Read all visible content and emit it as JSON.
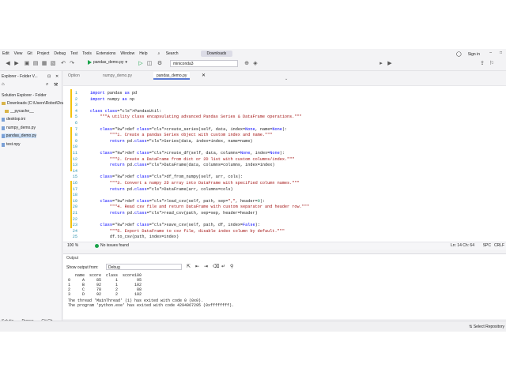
{
  "menu": {
    "items": [
      "Edit",
      "View",
      "Git",
      "Project",
      "Debug",
      "Test",
      "Tools",
      "Extensions",
      "Window",
      "Help"
    ],
    "search": "Search",
    "branch": "Downloads",
    "signin": "Sign in"
  },
  "toolbar": {
    "run_label": "pandas_demo.py",
    "env_label": "miniconda3"
  },
  "solution_explorer": {
    "title": "Explorer - Folder V...",
    "view_label": "Solution Explorer - Folder",
    "path": "Downloads (C:\\Users\\Robot\\Down",
    "items": [
      "__pycache__",
      "desktop.ini",
      "numpy_demo.py",
      "pandas_demo.py",
      "test.npy"
    ],
    "bottom_tabs": [
      "Solutio...",
      "Proper...",
      "Git Ch..."
    ]
  },
  "editor_tabs": [
    "Option",
    "numpy_demo.py",
    "pandas_demo.py"
  ],
  "code_lines": [
    {
      "n": "1",
      "t": "import pandas as pd"
    },
    {
      "n": "2",
      "t": "import numpy as np"
    },
    {
      "n": "3",
      "t": ""
    },
    {
      "n": "4",
      "t": "class PandasUtil:"
    },
    {
      "n": "5",
      "t": "    \"\"\"A utility class encapsulating advanced Pandas Series & DataFrame operations.\"\"\""
    },
    {
      "n": "6",
      "t": ""
    },
    {
      "n": "7",
      "t": "    def create_series(self, data, index=None, name=None):"
    },
    {
      "n": "8",
      "t": "        \"\"\"1. Create a pandas Series object with custom index and name.\"\"\""
    },
    {
      "n": "9",
      "t": "        return pd.Series(data, index=index, name=name)"
    },
    {
      "n": "10",
      "t": ""
    },
    {
      "n": "11",
      "t": "    def create_df(self, data, columns=None, index=None):"
    },
    {
      "n": "12",
      "t": "        \"\"\"2. Create a DataFrame from dict or 2D list with custom columns/index.\"\"\""
    },
    {
      "n": "13",
      "t": "        return pd.DataFrame(data, columns=columns, index=index)"
    },
    {
      "n": "14",
      "t": ""
    },
    {
      "n": "15",
      "t": "    def df_from_numpy(self, arr, cols):"
    },
    {
      "n": "16",
      "t": "        \"\"\"3. Convert a numpy 2D array into DataFrame with specified column names.\"\"\""
    },
    {
      "n": "17",
      "t": "        return pd.DataFrame(arr, columns=cols)"
    },
    {
      "n": "18",
      "t": ""
    },
    {
      "n": "19",
      "t": "    def load_csv(self, path, sep=\",\", header=0):"
    },
    {
      "n": "20",
      "t": "        \"\"\"4. Read csv file and return DataFrame with custom separator and header row.\"\"\""
    },
    {
      "n": "21",
      "t": "        return pd.read_csv(path, sep=sep, header=header)"
    },
    {
      "n": "22",
      "t": ""
    },
    {
      "n": "23",
      "t": "    def save_csv(self, path, df, index=False):"
    },
    {
      "n": "24",
      "t": "        \"\"\"5. Export DataFrame to csv file, disable index column by default.\"\"\""
    },
    {
      "n": "25",
      "t": "        df.to_csv(path, index=index)"
    }
  ],
  "editor_status": {
    "zoom": "100 %",
    "issues": "No issues found",
    "position": "Ln: 14  Ch: 64",
    "encoding": "SPC",
    "eol": "CRLF"
  },
  "output": {
    "title": "Output",
    "show_label": "Show output from:",
    "source": "Debug",
    "lines": [
      "   name  score  class  score100",
      "0     A     85      1        95",
      "1     B     92      1       102",
      "2     C     78      2        88",
      "3     D     92      2       102",
      "The thread 'MainThread' (1) has exited with code 0 (0x0).",
      "The program 'python.exe' has exited with code 4294967295 (0xffffffff)."
    ]
  },
  "app_status": {
    "select_repo": "Select Repository"
  }
}
